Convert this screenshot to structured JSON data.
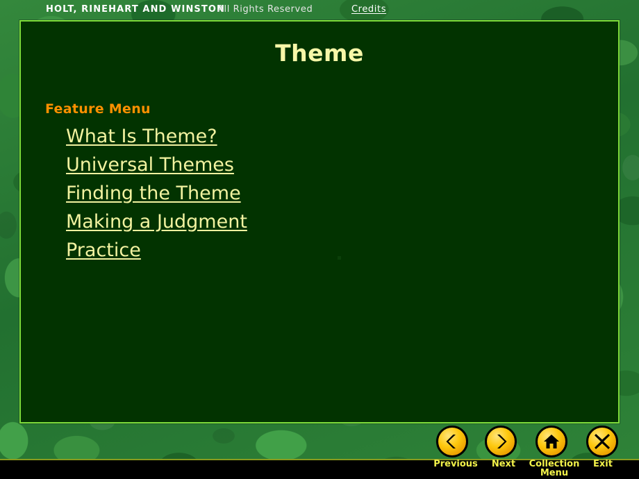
{
  "slide": {
    "title": "Theme",
    "feature_menu_heading": "Feature Menu",
    "menu_items": [
      {
        "label": "What Is Theme?"
      },
      {
        "label": "Universal Themes"
      },
      {
        "label": "Finding the Theme"
      },
      {
        "label": "Making a Judgment"
      },
      {
        "label": "Practice"
      }
    ]
  },
  "navigation": {
    "buttons": [
      {
        "icon": "chevron-left-icon",
        "label": "Previous"
      },
      {
        "icon": "chevron-right-icon",
        "label": "Next"
      },
      {
        "icon": "home-icon",
        "label": "Collection\nMenu"
      },
      {
        "icon": "close-x-icon",
        "label": "Exit"
      }
    ]
  },
  "footer": {
    "publisher": "HOLT, RINEHART AND WINSTON",
    "rights": "All Rights Reserved",
    "credits_label": "Credits"
  },
  "colors": {
    "panel_background": "#023300",
    "panel_border": "#7ddb3a",
    "title_text": "#f7f7a8",
    "heading_orange": "#ff9000",
    "link_text": "#f2f2a0",
    "nav_label": "#f2f24a",
    "button_gold": "#fdc80d",
    "footer_background": "#000000"
  }
}
